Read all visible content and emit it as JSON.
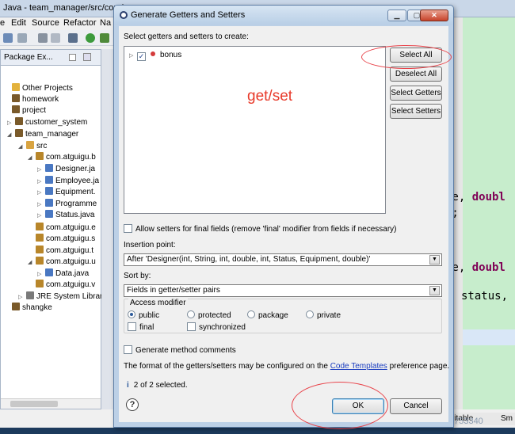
{
  "ide": {
    "window_title": "Java - team_manager/src/com/a",
    "menu": [
      "e",
      "Edit",
      "Source",
      "Refactor",
      "Na"
    ],
    "package_explorer": {
      "tab_label": "Package Ex...",
      "items": [
        {
          "label": "Other Projects",
          "icon_color": "#e3b23c"
        },
        {
          "label": "homework",
          "icon_color": "#7a5a2a"
        },
        {
          "label": "project",
          "icon_color": "#7a5a2a"
        },
        {
          "label": "customer_system",
          "icon_color": "#7a5a2a"
        },
        {
          "label": "team_manager",
          "icon_color": "#7a5a2a"
        },
        {
          "label": "src",
          "icon_color": "#d9a441"
        },
        {
          "label": "com.atguigu.b",
          "icon_color": "#b8862a"
        },
        {
          "label": "Designer.ja",
          "icon_color": "#4a78c2"
        },
        {
          "label": "Employee.ja",
          "icon_color": "#4a78c2"
        },
        {
          "label": "Equipment.",
          "icon_color": "#4a78c2"
        },
        {
          "label": "Programme",
          "icon_color": "#4a78c2"
        },
        {
          "label": "Status.java",
          "icon_color": "#4a78c2"
        },
        {
          "label": "com.atguigu.e",
          "icon_color": "#b8862a"
        },
        {
          "label": "com.atguigu.s",
          "icon_color": "#b8862a"
        },
        {
          "label": "com.atguigu.t",
          "icon_color": "#b8862a"
        },
        {
          "label": "com.atguigu.u",
          "icon_color": "#b8862a"
        },
        {
          "label": "Data.java",
          "icon_color": "#4a78c2"
        },
        {
          "label": "com.atguigu.v",
          "icon_color": "#b8862a"
        },
        {
          "label": "JRE System Librar",
          "icon_color": "#7a7a7a"
        },
        {
          "label": "shangke",
          "icon_color": "#7a5a2a"
        }
      ]
    },
    "code_lines": [
      {
        "text": "ge, ",
        "kw": "doubl"
      },
      {
        "text": ");",
        "kw": ""
      },
      {
        "text": "ge, ",
        "kw": "doubl"
      },
      {
        "text": "status,",
        "kw": ""
      }
    ],
    "status_right": [
      "ritable",
      "Sm"
    ],
    "watermark": "https://blog.csdn.net/qq_41753340"
  },
  "dialog": {
    "title": "Generate Getters and Setters",
    "select_label": "Select getters and setters to create:",
    "tree_item": "bonus",
    "annotation_text": "get/set",
    "buttons": {
      "select_all": "Select All",
      "deselect_all": "Deselect All",
      "select_getters": "Select Getters",
      "select_setters": "Select Setters",
      "ok": "OK",
      "cancel": "Cancel"
    },
    "allow_setters_label": "Allow setters for final fields (remove 'final' modifier from fields if necessary)",
    "insertion_point_label": "Insertion point:",
    "insertion_point_value": "After 'Designer(int, String, int, double, int, Status, Equipment, double)'",
    "sort_by_label": "Sort by:",
    "sort_by_value": "Fields in getter/setter pairs",
    "access_modifier_label": "Access modifier",
    "access": {
      "public": "public",
      "protected": "protected",
      "package": "package",
      "private": "private"
    },
    "final_label": "final",
    "synchronized_label": "synchronized",
    "generate_comments_label": "Generate method comments",
    "format_text_before": "The format of the getters/setters may be configured on the",
    "format_link": "Code Templates",
    "format_text_after": "preference page.",
    "status_count": "2 of 2 selected.",
    "selected_access": "public"
  }
}
